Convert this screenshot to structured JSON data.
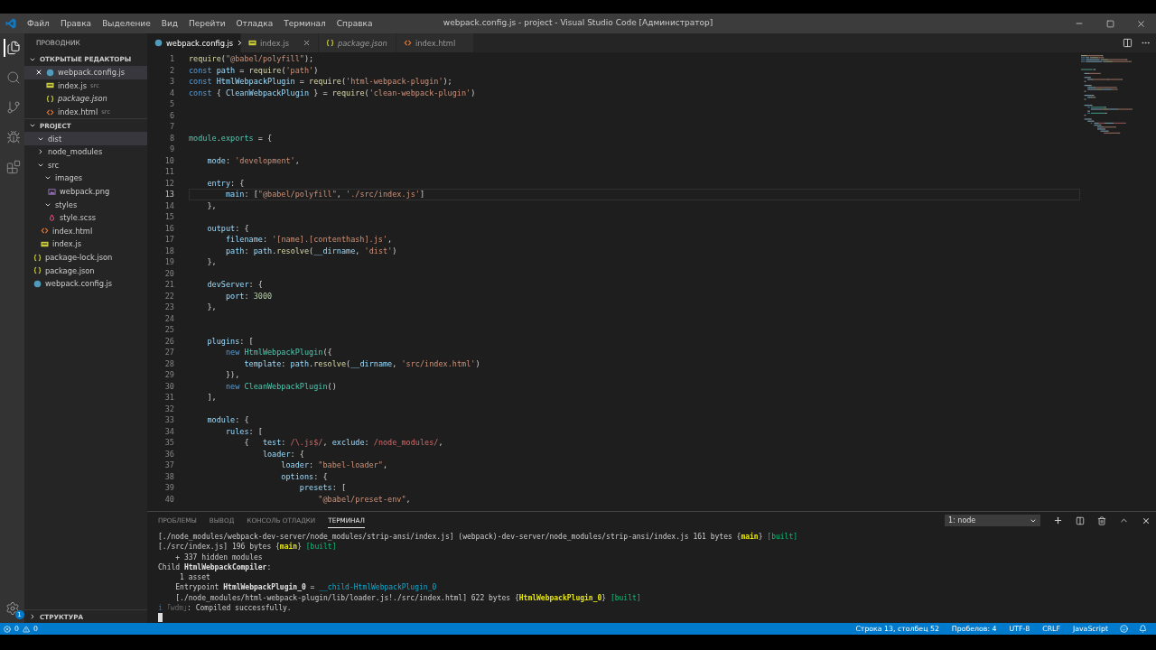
{
  "title_bar": {
    "menu": [
      "Файл",
      "Правка",
      "Выделение",
      "Вид",
      "Перейти",
      "Отладка",
      "Терминал",
      "Справка"
    ],
    "title": "webpack.config.js - project - Visual Studio Code [Администратор]"
  },
  "activity_bar": [
    {
      "kind": "files",
      "selected": true
    },
    {
      "kind": "search",
      "selected": false
    },
    {
      "kind": "source-control",
      "selected": false
    },
    {
      "kind": "debug",
      "selected": false
    },
    {
      "kind": "extensions",
      "selected": false
    }
  ],
  "settings_badge": "1",
  "sidebar": {
    "title": "ПРОВОДНИК",
    "open_editors": {
      "title": "ОТКРЫТЫЕ РЕДАКТОРЫ",
      "expanded": true,
      "items": [
        {
          "name": "webpack.config.js",
          "kind": "webpack",
          "preview": false,
          "selected": true
        },
        {
          "name": "index.js",
          "kind": "js",
          "description": "src",
          "preview": false,
          "selected": false
        },
        {
          "name": "package.json",
          "kind": "json",
          "preview": true,
          "selected": false
        },
        {
          "name": "index.html",
          "kind": "html",
          "description": "src",
          "preview": false,
          "selected": false
        }
      ]
    },
    "project": {
      "title": "PROJECT",
      "expanded": true,
      "items": [
        {
          "name": "dist",
          "kind": "folder",
          "expanded": true,
          "selected": true
        },
        {
          "name": "node_modules",
          "kind": "folder",
          "expanded": false,
          "selected": false
        },
        {
          "name": "src",
          "kind": "folder",
          "expanded": true,
          "selected": false,
          "children": [
            {
              "name": "images",
              "kind": "folder",
              "expanded": true,
              "selected": false,
              "children": [
                {
                  "name": "webpack.png",
                  "kind": "image",
                  "selected": false
                }
              ]
            },
            {
              "name": "styles",
              "kind": "folder",
              "expanded": true,
              "selected": false,
              "children": [
                {
                  "name": "style.scss",
                  "kind": "scss",
                  "selected": false
                }
              ]
            },
            {
              "name": "index.html",
              "kind": "html",
              "selected": false
            },
            {
              "name": "index.js",
              "kind": "js",
              "selected": false
            }
          ]
        },
        {
          "name": "package-lock.json",
          "kind": "json",
          "selected": false
        },
        {
          "name": "package.json",
          "kind": "json",
          "selected": false
        },
        {
          "name": "webpack.config.js",
          "kind": "webpack",
          "selected": false
        }
      ]
    },
    "outline": {
      "title": "СТРУКТУРА",
      "expanded": false
    }
  },
  "tabs": [
    {
      "label": "webpack.config.js",
      "kind": "webpack",
      "selected": true,
      "preview": false,
      "close": true
    },
    {
      "label": "index.js",
      "kind": "js",
      "selected": false,
      "preview": false,
      "close": true
    },
    {
      "label": "package.json",
      "kind": "json",
      "selected": false,
      "preview": true,
      "close": false
    },
    {
      "label": "index.html",
      "kind": "html",
      "selected": false,
      "preview": false,
      "close": false
    }
  ],
  "editor": {
    "lines": [
      {
        "number": "1",
        "current": false,
        "tokens": [
          {
            "kind": "fn",
            "text": "require"
          },
          {
            "kind": "p",
            "text": "("
          },
          {
            "kind": "str",
            "text": "\"@babel/polyfill\""
          },
          {
            "kind": "p",
            "text": ");"
          }
        ]
      },
      {
        "number": "2",
        "current": false,
        "tokens": [
          {
            "kind": "kw",
            "text": "const"
          },
          {
            "kind": "var",
            "text": " path"
          },
          {
            "kind": "p",
            "text": " = "
          },
          {
            "kind": "fn",
            "text": "require"
          },
          {
            "kind": "p",
            "text": "("
          },
          {
            "kind": "str",
            "text": "'path'"
          },
          {
            "kind": "p",
            "text": ")"
          }
        ]
      },
      {
        "number": "3",
        "current": false,
        "tokens": [
          {
            "kind": "kw",
            "text": "const"
          },
          {
            "kind": "var",
            "text": " HtmlWebpackPlugin"
          },
          {
            "kind": "p",
            "text": " = "
          },
          {
            "kind": "fn",
            "text": "require"
          },
          {
            "kind": "p",
            "text": "("
          },
          {
            "kind": "str",
            "text": "'html-webpack-plugin'"
          },
          {
            "kind": "p",
            "text": ");"
          }
        ]
      },
      {
        "number": "4",
        "current": false,
        "tokens": [
          {
            "kind": "kw",
            "text": "const"
          },
          {
            "kind": "p",
            "text": " { "
          },
          {
            "kind": "var",
            "text": "CleanWebpackPlugin"
          },
          {
            "kind": "p",
            "text": " } = "
          },
          {
            "kind": "fn",
            "text": "require"
          },
          {
            "kind": "p",
            "text": "("
          },
          {
            "kind": "str",
            "text": "'clean-webpack-plugin'"
          },
          {
            "kind": "p",
            "text": ")"
          }
        ]
      },
      {
        "number": "5",
        "current": false
      },
      {
        "number": "6",
        "current": false
      },
      {
        "number": "7",
        "current": false
      },
      {
        "number": "8",
        "current": false,
        "tokens": [
          {
            "kind": "cls",
            "text": "module"
          },
          {
            "kind": "p",
            "text": "."
          },
          {
            "kind": "cls",
            "text": "exports"
          },
          {
            "kind": "p",
            "text": " = {"
          }
        ]
      },
      {
        "number": "9",
        "current": false
      },
      {
        "number": "10",
        "current": false,
        "tokens": [
          {
            "kind": "prop",
            "text": "    mode"
          },
          {
            "kind": "p",
            "text": ": "
          },
          {
            "kind": "str",
            "text": "'development'"
          },
          {
            "kind": "p",
            "text": ","
          }
        ]
      },
      {
        "number": "11",
        "current": false
      },
      {
        "number": "12",
        "current": false,
        "tokens": [
          {
            "kind": "prop",
            "text": "    entry"
          },
          {
            "kind": "p",
            "text": ": {"
          }
        ]
      },
      {
        "number": "13",
        "current": true,
        "tokens": [
          {
            "kind": "prop",
            "text": "        main"
          },
          {
            "kind": "p",
            "text": ": ["
          },
          {
            "kind": "str",
            "text": "\"@babel/polyfill\""
          },
          {
            "kind": "p",
            "text": ", "
          },
          {
            "kind": "str",
            "text": "'./src/index.js'"
          },
          {
            "kind": "p",
            "text": "]"
          }
        ]
      },
      {
        "number": "14",
        "current": false,
        "tokens": [
          {
            "kind": "p",
            "text": "    },"
          }
        ]
      },
      {
        "number": "15",
        "current": false
      },
      {
        "number": "16",
        "current": false,
        "tokens": [
          {
            "kind": "prop",
            "text": "    output"
          },
          {
            "kind": "p",
            "text": ": {"
          }
        ]
      },
      {
        "number": "17",
        "current": false,
        "tokens": [
          {
            "kind": "prop",
            "text": "        filename"
          },
          {
            "kind": "p",
            "text": ": "
          },
          {
            "kind": "str",
            "text": "'[name].[contenthash].js'"
          },
          {
            "kind": "p",
            "text": ","
          }
        ]
      },
      {
        "number": "18",
        "current": false,
        "tokens": [
          {
            "kind": "prop",
            "text": "        path"
          },
          {
            "kind": "p",
            "text": ": "
          },
          {
            "kind": "var",
            "text": "path"
          },
          {
            "kind": "p",
            "text": "."
          },
          {
            "kind": "fn",
            "text": "resolve"
          },
          {
            "kind": "p",
            "text": "("
          },
          {
            "kind": "var",
            "text": "__dirname"
          },
          {
            "kind": "p",
            "text": ", "
          },
          {
            "kind": "str",
            "text": "'dist'"
          },
          {
            "kind": "p",
            "text": ")"
          }
        ]
      },
      {
        "number": "19",
        "current": false,
        "tokens": [
          {
            "kind": "p",
            "text": "    },"
          }
        ]
      },
      {
        "number": "20",
        "current": false
      },
      {
        "number": "21",
        "current": false,
        "tokens": [
          {
            "kind": "prop",
            "text": "    devServer"
          },
          {
            "kind": "p",
            "text": ": {"
          }
        ]
      },
      {
        "number": "22",
        "current": false,
        "tokens": [
          {
            "kind": "prop",
            "text": "        port"
          },
          {
            "kind": "p",
            "text": ": "
          },
          {
            "kind": "num",
            "text": "3000"
          }
        ]
      },
      {
        "number": "23",
        "current": false,
        "tokens": [
          {
            "kind": "p",
            "text": "    },"
          }
        ]
      },
      {
        "number": "24",
        "current": false
      },
      {
        "number": "25",
        "current": false
      },
      {
        "number": "26",
        "current": false,
        "tokens": [
          {
            "kind": "prop",
            "text": "    plugins"
          },
          {
            "kind": "p",
            "text": ": ["
          }
        ]
      },
      {
        "number": "27",
        "current": false,
        "tokens": [
          {
            "kind": "kw",
            "text": "        new"
          },
          {
            "kind": "cls",
            "text": " HtmlWebpackPlugin"
          },
          {
            "kind": "p",
            "text": "({"
          }
        ]
      },
      {
        "number": "28",
        "current": false,
        "tokens": [
          {
            "kind": "prop",
            "text": "            template"
          },
          {
            "kind": "p",
            "text": ": "
          },
          {
            "kind": "var",
            "text": "path"
          },
          {
            "kind": "p",
            "text": "."
          },
          {
            "kind": "fn",
            "text": "resolve"
          },
          {
            "kind": "p",
            "text": "("
          },
          {
            "kind": "var",
            "text": "__dirname"
          },
          {
            "kind": "p",
            "text": ", "
          },
          {
            "kind": "str",
            "text": "'src/index.html'"
          },
          {
            "kind": "p",
            "text": ")"
          }
        ]
      },
      {
        "number": "29",
        "current": false,
        "tokens": [
          {
            "kind": "p",
            "text": "        }),"
          }
        ]
      },
      {
        "number": "30",
        "current": false,
        "tokens": [
          {
            "kind": "kw",
            "text": "        new"
          },
          {
            "kind": "cls",
            "text": " CleanWebpackPlugin"
          },
          {
            "kind": "p",
            "text": "()"
          }
        ]
      },
      {
        "number": "31",
        "current": false,
        "tokens": [
          {
            "kind": "p",
            "text": "    ],"
          }
        ]
      },
      {
        "number": "32",
        "current": false
      },
      {
        "number": "33",
        "current": false,
        "tokens": [
          {
            "kind": "prop",
            "text": "    module"
          },
          {
            "kind": "p",
            "text": ": {"
          }
        ]
      },
      {
        "number": "34",
        "current": false,
        "tokens": [
          {
            "kind": "prop",
            "text": "        rules"
          },
          {
            "kind": "p",
            "text": ": ["
          }
        ]
      },
      {
        "number": "35",
        "current": false,
        "tokens": [
          {
            "kind": "p",
            "text": "            {"
          },
          {
            "kind": "prop",
            "text": "   test"
          },
          {
            "kind": "p",
            "text": ": "
          },
          {
            "kind": "re",
            "text": "/\\.js$/"
          },
          {
            "kind": "p",
            "text": ", "
          },
          {
            "kind": "prop",
            "text": "exclude"
          },
          {
            "kind": "p",
            "text": ": "
          },
          {
            "kind": "re",
            "text": "/node_modules/"
          },
          {
            "kind": "p",
            "text": ","
          }
        ]
      },
      {
        "number": "36",
        "current": false,
        "tokens": [
          {
            "kind": "prop",
            "text": "                loader"
          },
          {
            "kind": "p",
            "text": ": {"
          }
        ]
      },
      {
        "number": "37",
        "current": false,
        "tokens": [
          {
            "kind": "prop",
            "text": "                    loader"
          },
          {
            "kind": "p",
            "text": ": "
          },
          {
            "kind": "str",
            "text": "\"babel-loader\""
          },
          {
            "kind": "p",
            "text": ","
          }
        ]
      },
      {
        "number": "38",
        "current": false,
        "tokens": [
          {
            "kind": "prop",
            "text": "                    options"
          },
          {
            "kind": "p",
            "text": ": {"
          }
        ]
      },
      {
        "number": "39",
        "current": false,
        "tokens": [
          {
            "kind": "prop",
            "text": "                        presets"
          },
          {
            "kind": "p",
            "text": ": ["
          }
        ]
      },
      {
        "number": "40",
        "current": false,
        "tokens": [
          {
            "kind": "str",
            "text": "                            \"@babel/preset-env\""
          },
          {
            "kind": "p",
            "text": ","
          }
        ]
      }
    ]
  },
  "panel": {
    "tabs": [
      {
        "label": "ПРОБЛЕМЫ",
        "selected": false
      },
      {
        "label": "ВЫВОД",
        "selected": false
      },
      {
        "label": "КОНСОЛЬ ОТЛАДКИ",
        "selected": false
      },
      {
        "label": "ТЕРМИНАЛ",
        "selected": true
      }
    ],
    "terminal_select": "1: node",
    "terminal": {
      "cursor": true,
      "lines": [
        [
          {
            "kind": "p",
            "text": "[./node_modules/webpack-dev-server/node_modules/strip-ansi/index.js] (webpack)-dev-server/node_modules/strip-ansi/index.js 161 bytes {"
          },
          {
            "kind": "hl",
            "text": "main"
          },
          {
            "kind": "p",
            "text": "} "
          },
          {
            "kind": "ok",
            "text": "[built]"
          }
        ],
        [
          {
            "kind": "p",
            "text": "[./src/index.js] 196 bytes {"
          },
          {
            "kind": "hl",
            "text": "main"
          },
          {
            "kind": "p",
            "text": "} "
          },
          {
            "kind": "ok",
            "text": "[built]"
          }
        ],
        [
          {
            "kind": "p",
            "text": "    + 337 hidden modules"
          }
        ],
        [
          {
            "kind": "p",
            "text": "Child "
          },
          {
            "kind": "b",
            "text": "HtmlWebpackCompiler"
          },
          {
            "kind": "p",
            "text": ":"
          }
        ],
        [
          {
            "kind": "p",
            "text": "     1 asset"
          }
        ],
        [
          {
            "kind": "p",
            "text": "    Entrypoint "
          },
          {
            "kind": "b",
            "text": "HtmlWebpackPlugin_0"
          },
          {
            "kind": "p",
            "text": " = "
          },
          {
            "kind": "teal",
            "text": "__child-HtmlWebpackPlugin_0"
          }
        ],
        [
          {
            "kind": "p",
            "text": "    [./node_modules/html-webpack-plugin/lib/loader.js!./src/index.html] 622 bytes {"
          },
          {
            "kind": "hl",
            "text": "HtmlWebpackPlugin_0"
          },
          {
            "kind": "p",
            "text": "} "
          },
          {
            "kind": "ok",
            "text": "[built]"
          }
        ],
        [
          {
            "kind": "info",
            "text": "i"
          },
          {
            "kind": "dim",
            "text": " ｢wdm｣"
          },
          {
            "kind": "p",
            "text": ": Compiled successfully."
          }
        ]
      ]
    }
  },
  "status_bar": {
    "errors": "0",
    "warnings": "0",
    "items": [
      "Строка 13, столбец 52",
      "Пробелов: 4",
      "UTF-8",
      "CRLF",
      "JavaScript"
    ]
  }
}
